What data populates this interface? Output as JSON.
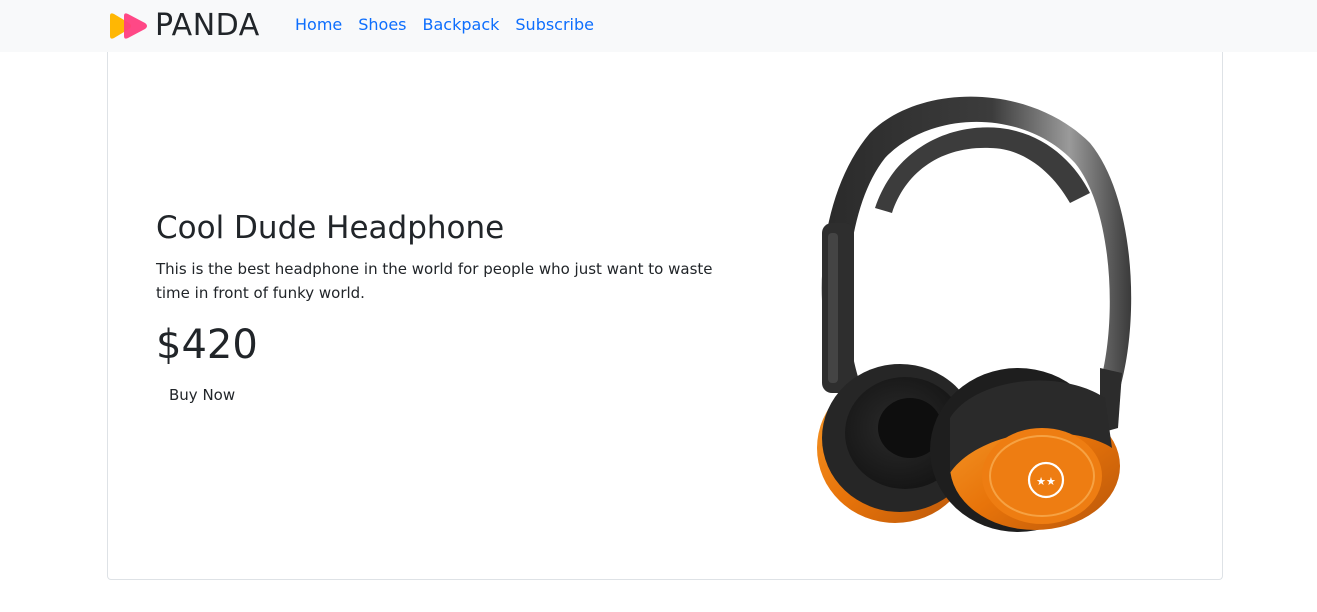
{
  "brand": {
    "name": "PANDA",
    "logo_icon": "panda-play-logo-icon",
    "colors": [
      "#ffb703",
      "#ff3e7f"
    ]
  },
  "nav": {
    "items": [
      {
        "label": "Home"
      },
      {
        "label": "Shoes"
      },
      {
        "label": "Backpack"
      },
      {
        "label": "Subscribe"
      }
    ],
    "link_color": "#0d6efd"
  },
  "product": {
    "title": "Cool Dude Headphone",
    "description": "This is the best headphone in the world for people who just want to waste time in front of funky world.",
    "price": "$420",
    "buy_label": "Buy Now",
    "image_icon": "headphone-image",
    "accent_color": "#f07e0c"
  }
}
